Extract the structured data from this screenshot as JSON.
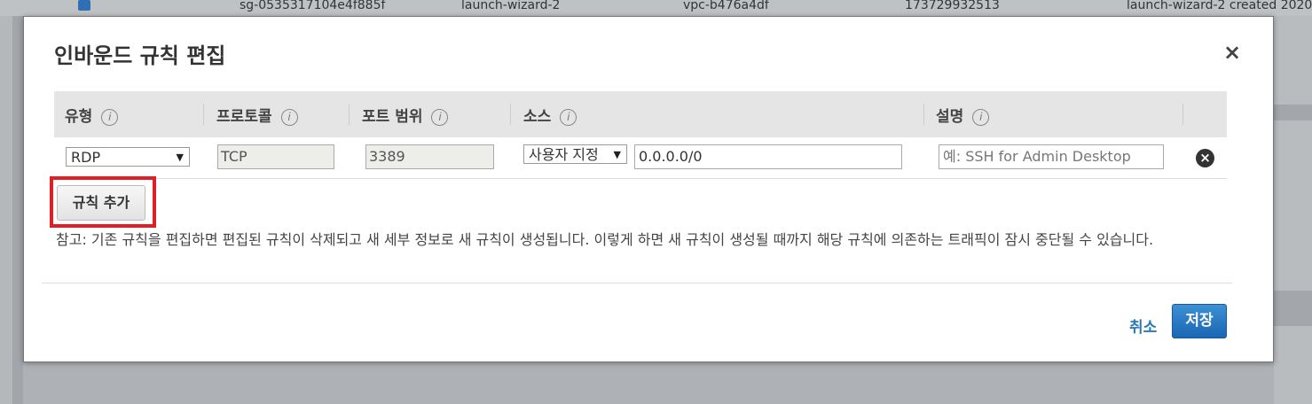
{
  "background_row": {
    "group_id": "sg-0535317104e4f885f",
    "group_name": "launch-wizard-2",
    "vpc_id": "vpc-b476a4df",
    "owner": "173729932513",
    "description": "launch-wizard-2 created 2020"
  },
  "modal": {
    "title": "인바운드 규칙 편집",
    "close_label": "×"
  },
  "table": {
    "headers": {
      "type": "유형",
      "protocol": "프로토콜",
      "port_range": "포트 범위",
      "source": "소스",
      "description": "설명"
    },
    "info_glyph": "i",
    "row": {
      "type": "RDP",
      "protocol": "TCP",
      "port_range": "3389",
      "source_type": "사용자 지정",
      "source_cidr": "0.0.0.0/0",
      "description_placeholder": "예: SSH for Admin Desktop",
      "dropdown_arrow": "▼",
      "remove_glyph": "×"
    }
  },
  "add_rule_label": "규칙 추가",
  "note": "참고: 기존 규칙을 편집하면 편집된 규칙이 삭제되고 새 세부 정보로 새 규칙이 생성됩니다. 이렇게 하면 새 규칙이 생성될 때까지 해당 규칙에 의존하는 트래픽이 잠시 중단될 수 있습니다.",
  "footer": {
    "cancel_label": "취소",
    "save_label": "저장"
  },
  "colors": {
    "primary_button": "#1a66b3",
    "link": "#2a7ab9",
    "highlight": "#e01e24"
  }
}
